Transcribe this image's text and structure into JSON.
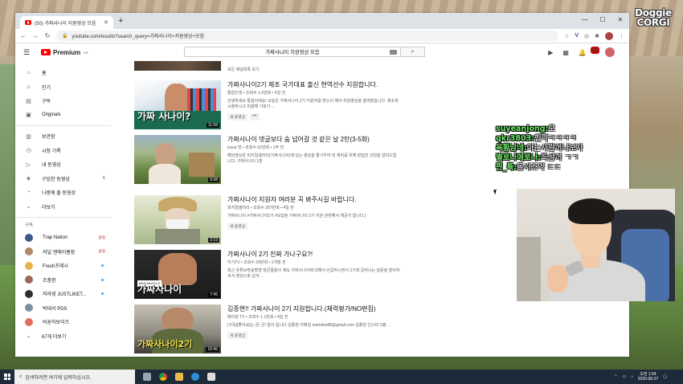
{
  "overlay": {
    "logo_line1": "Doggie",
    "logo_line2": "CORGI"
  },
  "browser": {
    "tab_title": "(50) 가짜사나이 지원영상 모음",
    "url": "youtube.com/results?search_query=가짜사나이+지원영상+모음",
    "new_tab": "+",
    "minimize": "—",
    "maximize": "☐",
    "close": "✕"
  },
  "youtube": {
    "logo_text": "Premium",
    "logo_region": "KR",
    "search_value": "가짜사나이 지원영상 모음",
    "notifications_count": "9+"
  },
  "sidebar": {
    "main": [
      {
        "label": "홈",
        "icon": "home-icon"
      },
      {
        "label": "인기",
        "icon": "fire-icon"
      },
      {
        "label": "구독",
        "icon": "subscriptions-icon"
      },
      {
        "label": "Originals",
        "icon": "originals-icon"
      }
    ],
    "library": [
      {
        "label": "보관함",
        "icon": "library-icon"
      },
      {
        "label": "시청 기록",
        "icon": "history-icon"
      },
      {
        "label": "내 동영상",
        "icon": "my-videos-icon"
      },
      {
        "label": "구입한 동영상",
        "icon": "purchases-icon",
        "count": "6"
      },
      {
        "label": "나중에 볼 동영상",
        "icon": "watch-later-icon"
      },
      {
        "label": "더보기",
        "icon": "chevron-down-icon"
      }
    ],
    "subs_header": "구독",
    "subscriptions": [
      {
        "label": "Trap Nation",
        "color": "#3c5a86",
        "marker": "live"
      },
      {
        "label": "저널 엔에이홍장",
        "color": "#b08968",
        "marker": "live"
      },
      {
        "label": "Fresh프레시",
        "color": "#e9b44c",
        "marker": "new"
      },
      {
        "label": "조충현",
        "color": "#9d6b53",
        "marker": "new"
      },
      {
        "label": "저라영 JUSTLIKET...",
        "color": "#2f2f2f",
        "marker": "new"
      },
      {
        "label": "박대서 PDS",
        "color": "#7b8fa3",
        "marker": "none"
      },
      {
        "label": "비숑하보이즈",
        "color": "#e26b5d",
        "marker": "none"
      }
    ],
    "more_label": "67개 더보기",
    "live_marker": "((•))"
  },
  "results": {
    "partial_meta": "모든 채널목록 보기",
    "videos": [
      {
        "title": "가짜사나이2기 제조 국가대표 출신 현역선수 지원합니다.",
        "meta": "통합인생 • 조회수 1.6만회 • 5일 전",
        "desc_line1": "안녕하세요 통합이에요! 오늘은 가짜사나이 2기 지원자를 받는다 해서 지원영상을 올려봤습니다. 제조계",
        "desc_line2": "시청하시고 미흡해 기회가 ...",
        "badges": [
          "새 동영상",
          "4K"
        ],
        "duration": "11:58",
        "thumb_text": "가짜 사나이?"
      },
      {
        "title": "가짜사나이 댓글보다 숨 넘어갈 것 같은 날 2탄(3-5화)",
        "meta": "issue 맛 • 조회수 62만회 • 1주 전",
        "desc_line1": "해당영상은 피지컬갤러리(가짜사나이)에 있는 영상을 즐기우여 및 재미를 위해 편집한 것임을 알려드립",
        "desc_line2": "니다. 가짜사나이 1편",
        "badges": [],
        "duration": "9:38",
        "thumb_text": ""
      },
      {
        "title": "가짜사나이 지원자 여러분 꼭 봐주시길 바랍니다.",
        "meta": "피지컬갤러리 • 조회수 267만회 • 4일 전",
        "desc_line1": "가짜사나이 #가짜사나이2기 #모집된 가짜사나이 2기 지원 관련해서 재공지 합니다.)",
        "desc_line2": "",
        "badges": [
          "새 동영상"
        ],
        "duration": "2:19",
        "thumb_text": ""
      },
      {
        "title": "가짜사나이 2기 진짜 가나구요?!",
        "meta": "지기TV • 조회수 29만회 • 1개월 전",
        "desc_line1": "최근 유튜브방송할명 땅콘롱들이 계속 가짜사나이에 대해서 언급하시면서 2기에 갈꺼냐는 질문을 많이하",
        "desc_line2": "셔서 영상으로 남겨 ...",
        "badges": [],
        "duration": "7:45",
        "thumb_text": "가짜사나이"
      },
      {
        "title": "김종현!! 가짜사나이 2기 지원합니다.(체력평가/NO편집)",
        "meta": "메이킹 TV • 조회수 1.1만회 • 4일 전",
        "desc_line1": "[구독][좋아요]는 큰! 큰! 힘이 됩니다 김종현 이메일 memkim88@gmail.com 김종현 인스타그램 ...",
        "desc_line2": "",
        "badges": [
          "새 동영상"
        ],
        "duration": "10:46",
        "thumb_text": "가짜사나이2기"
      }
    ]
  },
  "chat": [
    {
      "user": "suyeanjong:",
      "text": "오"
    },
    {
      "user": "qkr3803:",
      "text": "힘약ㅋㅋㅋㅋ"
    },
    {
      "user": "옥황남네:",
      "text": "아는사람꺼나보자"
    },
    {
      "user": "별로나메로나:",
      "text": "특삼꺼 ㄱㄱ"
    },
    {
      "user": "찐_특:",
      "text": "올사조약 ㄷㄷ"
    }
  ],
  "taskbar": {
    "search_placeholder": "검색하려면 여기에 입력하십시오.",
    "time": "오전 1:54",
    "date": "2020-08-27"
  }
}
